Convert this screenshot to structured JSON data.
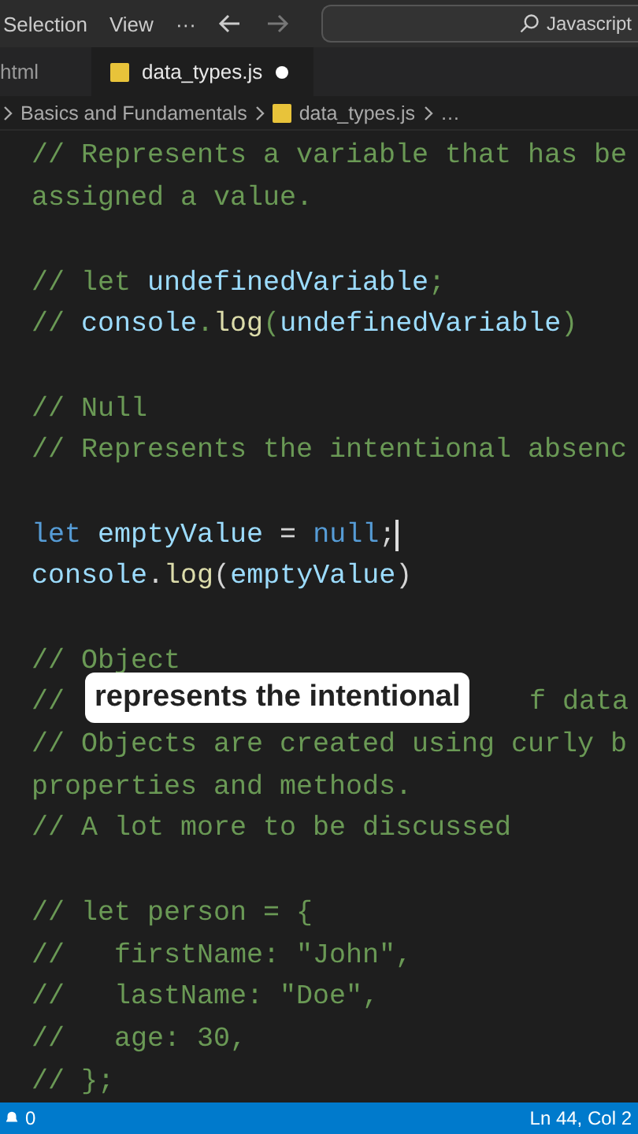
{
  "menu": [
    "Selection",
    "View",
    "···"
  ],
  "search": {
    "value": "Javascript"
  },
  "tabs": [
    {
      "label": "html",
      "selected": false,
      "modified": false
    },
    {
      "label": "data_types.js",
      "selected": true,
      "modified": true
    }
  ],
  "breadcrumb": {
    "folder": "Basics and Fundamentals",
    "file": "data_types.js",
    "more": "…"
  },
  "lines": [
    {
      "kind": "code",
      "tokens": [
        {
          "t": "// Represents a variable that has be",
          "kind": "comment"
        }
      ]
    },
    {
      "kind": "code",
      "tokens": [
        {
          "t": "assigned a value.",
          "kind": "comment"
        }
      ]
    },
    {
      "kind": "blank"
    },
    {
      "kind": "code",
      "tokens": [
        {
          "t": "// let ",
          "kind": "comment"
        },
        {
          "t": "undefinedVariable",
          "kind": "var"
        },
        {
          "t": ";",
          "kind": "comment"
        }
      ]
    },
    {
      "kind": "code",
      "tokens": [
        {
          "t": "// ",
          "kind": "comment"
        },
        {
          "t": "console",
          "kind": "var"
        },
        {
          "t": ".",
          "kind": "comment"
        },
        {
          "t": "log",
          "kind": "func"
        },
        {
          "t": "(",
          "kind": "comment"
        },
        {
          "t": "undefinedVariable",
          "kind": "var"
        },
        {
          "t": ")",
          "kind": "comment"
        }
      ]
    },
    {
      "kind": "blank"
    },
    {
      "kind": "code",
      "tokens": [
        {
          "t": "// Null",
          "kind": "comment"
        }
      ]
    },
    {
      "kind": "code",
      "tokens": [
        {
          "t": "// Represents the intentional absenc",
          "kind": "comment"
        }
      ]
    },
    {
      "kind": "blank"
    },
    {
      "kind": "code",
      "cursor": true,
      "tokens": [
        {
          "t": "let ",
          "kind": "keyword"
        },
        {
          "t": "emptyValue",
          "kind": "var"
        },
        {
          "t": " = ",
          "kind": "plain"
        },
        {
          "t": "null",
          "kind": "keyword"
        },
        {
          "t": ";",
          "kind": "plain"
        }
      ]
    },
    {
      "kind": "code",
      "tokens": [
        {
          "t": "console",
          "kind": "var"
        },
        {
          "t": ".",
          "kind": "plain"
        },
        {
          "t": "log",
          "kind": "func"
        },
        {
          "t": "(",
          "kind": "plain"
        },
        {
          "t": "emptyValue",
          "kind": "var"
        },
        {
          "t": ")",
          "kind": "plain"
        }
      ]
    },
    {
      "kind": "blank"
    },
    {
      "kind": "code",
      "tokens": [
        {
          "t": "// Object",
          "kind": "comment"
        }
      ]
    },
    {
      "kind": "covered",
      "left": "//",
      "right": "f data",
      "caption": "represents the intentional"
    },
    {
      "kind": "code",
      "tokens": [
        {
          "t": "// Objects are created using curly b",
          "kind": "comment"
        }
      ]
    },
    {
      "kind": "code",
      "tokens": [
        {
          "t": "properties and methods.",
          "kind": "comment"
        }
      ]
    },
    {
      "kind": "code",
      "tokens": [
        {
          "t": "// A lot more to be discussed",
          "kind": "comment"
        }
      ]
    },
    {
      "kind": "blank"
    },
    {
      "kind": "code",
      "tokens": [
        {
          "t": "// let person = {",
          "kind": "comment"
        }
      ]
    },
    {
      "kind": "code",
      "tokens": [
        {
          "t": "//   firstName: \"John\",",
          "kind": "comment"
        }
      ]
    },
    {
      "kind": "code",
      "tokens": [
        {
          "t": "//   lastName: \"Doe\",",
          "kind": "comment"
        }
      ]
    },
    {
      "kind": "code",
      "tokens": [
        {
          "t": "//   age: 30,",
          "kind": "comment"
        }
      ]
    },
    {
      "kind": "code",
      "tokens": [
        {
          "t": "// };",
          "kind": "comment"
        }
      ]
    }
  ],
  "status": {
    "count": "0",
    "position": "Ln 44, Col 2"
  }
}
